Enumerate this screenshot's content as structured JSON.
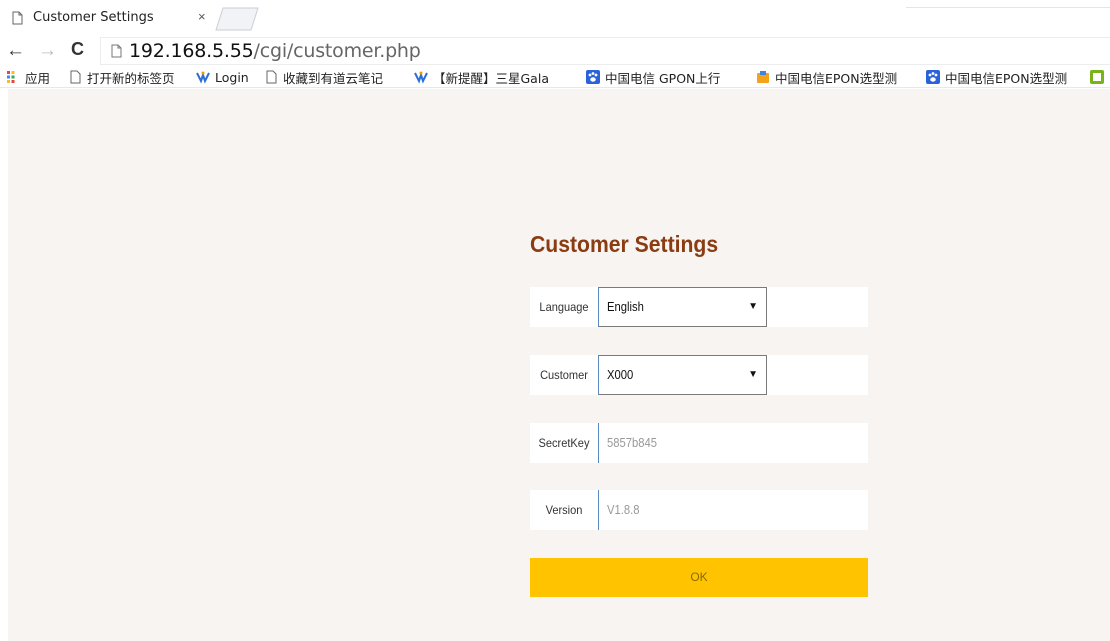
{
  "browser": {
    "tab": {
      "title": "Customer Settings",
      "close": "×"
    },
    "toolbar": {
      "back": "←",
      "forward": "→",
      "reload": "C",
      "url_host": "192.168.5.55",
      "url_path": "/cgi/customer.php"
    },
    "bookmarks": [
      {
        "label": "应用",
        "icon": "apps-grid-icon"
      },
      {
        "label": "打开新的标签页",
        "icon": "page-icon"
      },
      {
        "label": "Login",
        "icon": "network-logo-icon"
      },
      {
        "label": "收藏到有道云笔记",
        "icon": "page-icon"
      },
      {
        "label": "【新提醒】三星Gala",
        "icon": "network-logo-icon"
      },
      {
        "label": "中国电信 GPON上行",
        "icon": "paw-icon"
      },
      {
        "label": "中国电信EPON选型测",
        "icon": "folder-icon"
      },
      {
        "label": "中国电信EPON选型测",
        "icon": "paw-icon"
      }
    ]
  },
  "page": {
    "title": "Customer Settings",
    "fields": {
      "language": {
        "label": "Language",
        "value": "English"
      },
      "customer": {
        "label": "Customer",
        "value": "X000"
      },
      "secretkey": {
        "label": "SecretKey",
        "value": "5857b845"
      },
      "version": {
        "label": "Version",
        "value": "V1.8.8"
      }
    },
    "ok_label": "OK"
  },
  "colors": {
    "heading": "#8a3c12",
    "page_background": "#f8f4f2",
    "button": "#ffc300",
    "separator": "#5b8ac0"
  }
}
